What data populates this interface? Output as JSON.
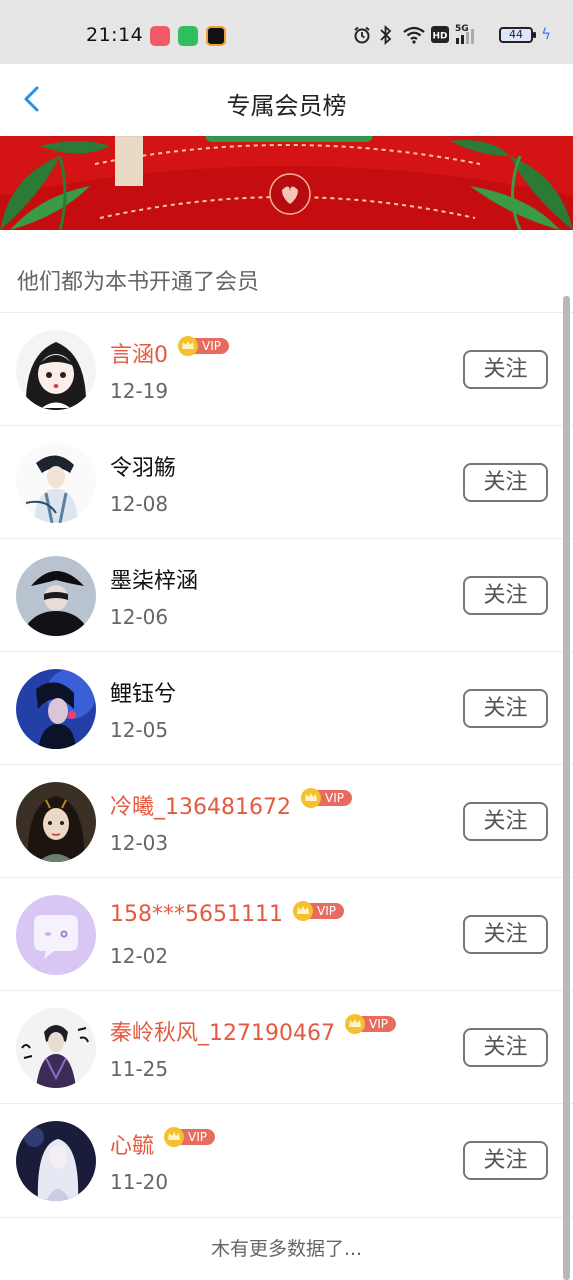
{
  "status_bar": {
    "time": "21:14",
    "battery": "44",
    "network": "5G",
    "icons": [
      "alarm-icon",
      "bluetooth-icon",
      "wifi-icon",
      "hd-icon",
      "signal-icon",
      "battery-icon",
      "charging-icon"
    ]
  },
  "header": {
    "title": "专属会员榜",
    "back_icon": "chevron-left-icon"
  },
  "colors": {
    "accent": "#2a8fe0",
    "vip_name": "#e35a3f",
    "banner_red": "#d41414"
  },
  "list": {
    "subtitle": "他们都为本书开通了会员",
    "vip_badge": "VIP",
    "follow_label": "关注",
    "members": [
      {
        "name": "言涵0",
        "date": "12-19",
        "vip": true
      },
      {
        "name": "令羽觞",
        "date": "12-08",
        "vip": false
      },
      {
        "name": "墨柒梓涵",
        "date": "12-06",
        "vip": false
      },
      {
        "name": "鲤钰兮",
        "date": "12-05",
        "vip": false
      },
      {
        "name": "冷曦_136481672",
        "date": "12-03",
        "vip": true
      },
      {
        "name": "158***5651111",
        "date": "12-02",
        "vip": true
      },
      {
        "name": "秦岭秋风_127190467",
        "date": "11-25",
        "vip": true
      },
      {
        "name": "心毓",
        "date": "11-20",
        "vip": true
      }
    ],
    "footer": "木有更多数据了..."
  }
}
